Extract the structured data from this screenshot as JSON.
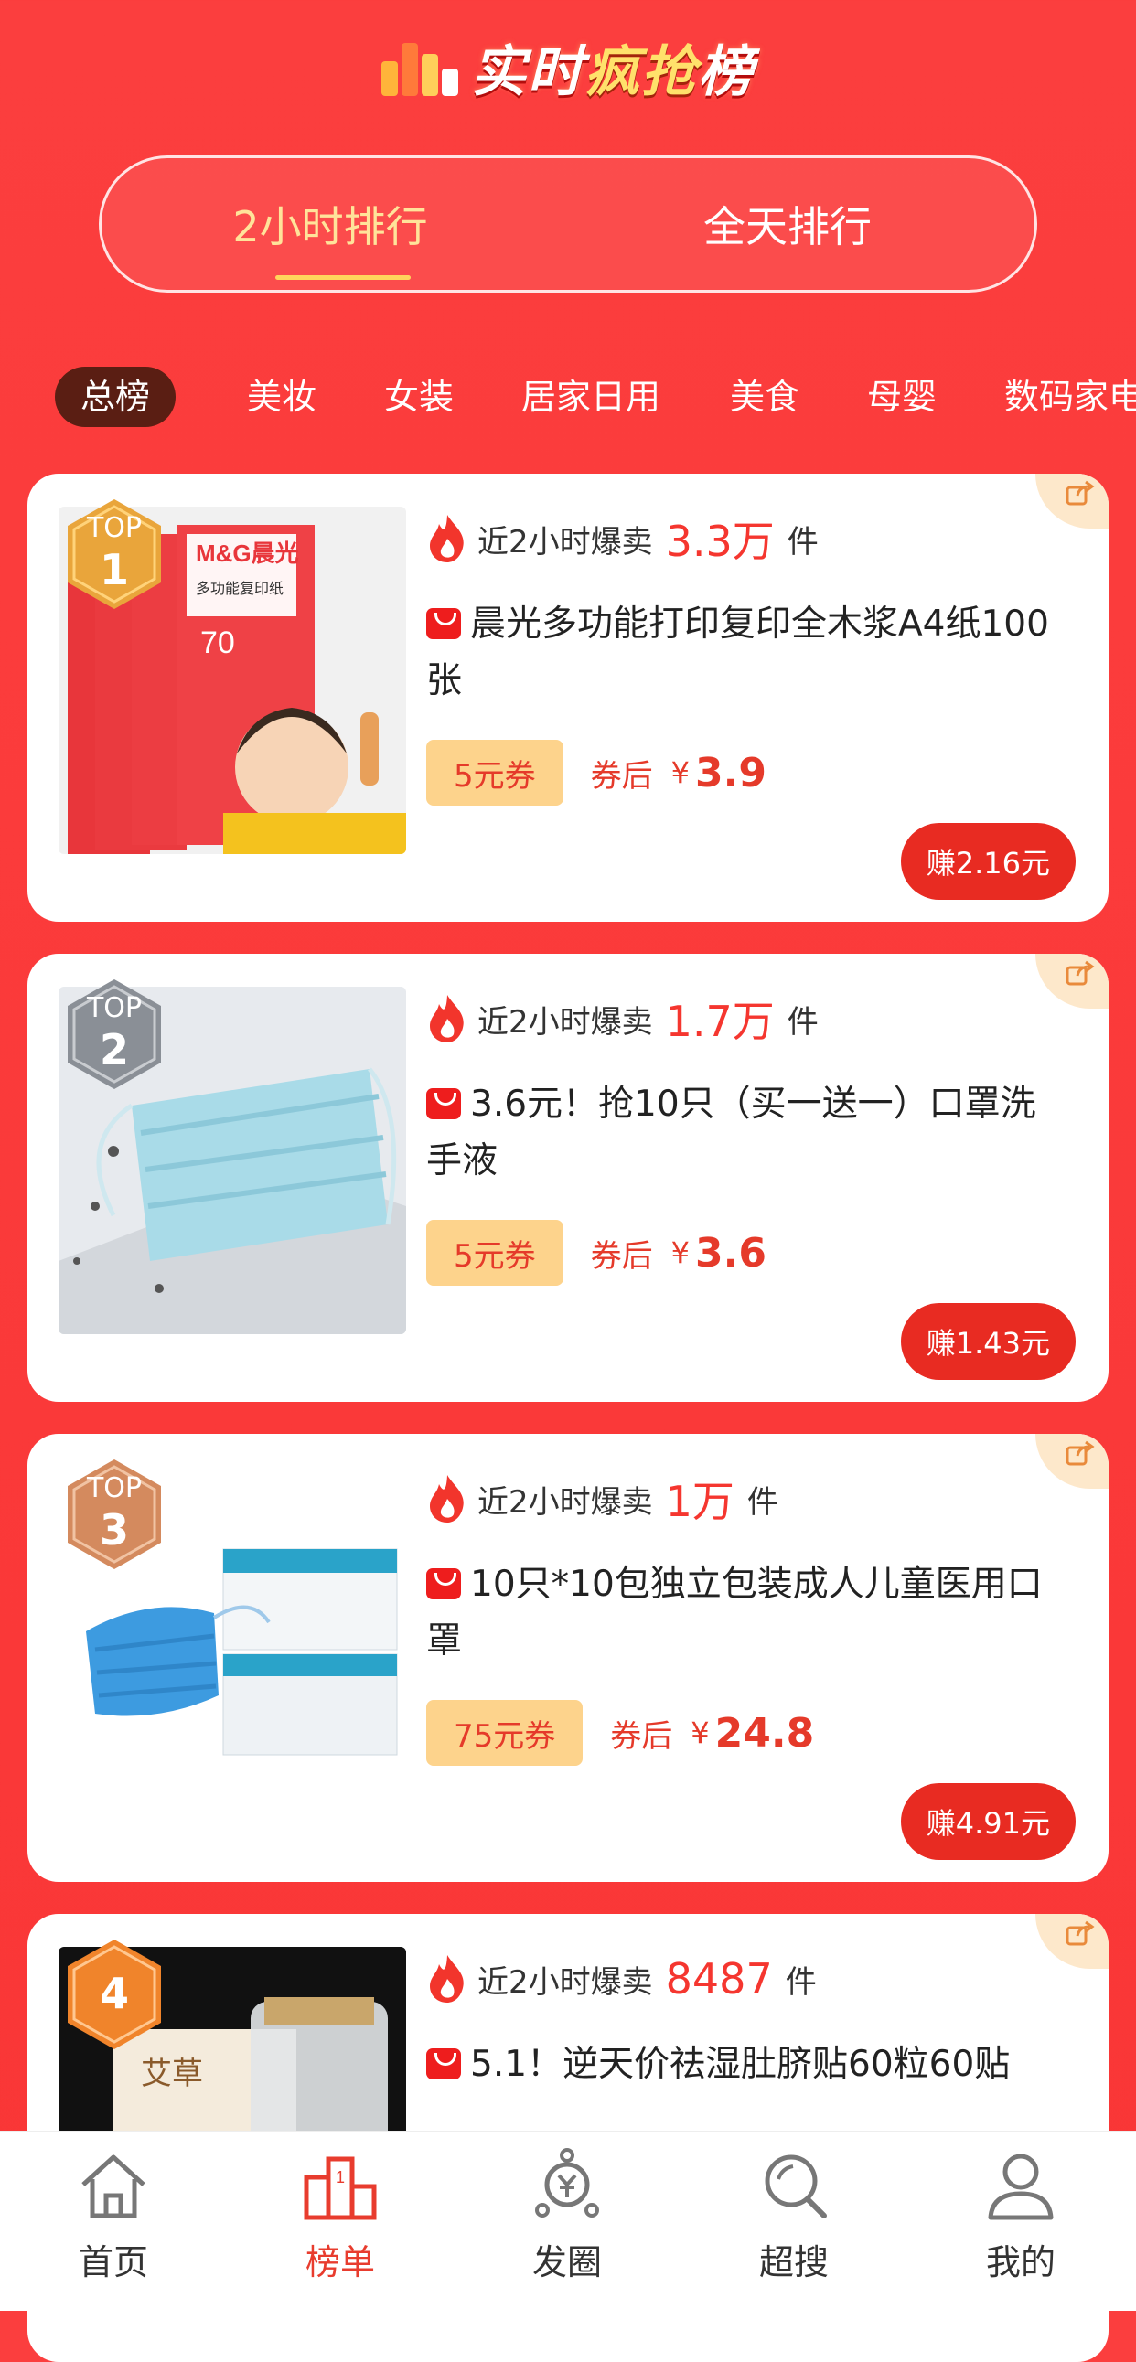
{
  "header": {
    "title_normal": "实时",
    "title_hot": "疯抢",
    "title_end": "榜"
  },
  "tabs": [
    {
      "label": "2小时排行"
    },
    {
      "label": "全天排行"
    }
  ],
  "categories": [
    "总榜",
    "美妆",
    "女装",
    "居家日用",
    "美食",
    "母婴",
    "数码家电"
  ],
  "common": {
    "hot_label": "近2小时爆卖",
    "unit": "件",
    "after_label": "券后",
    "currency": "¥"
  },
  "products": [
    {
      "badge_top": "TOP",
      "rank": "1",
      "sales": "3.3万",
      "title": "晨光多功能打印复印全木浆A4纸100张",
      "coupon": "5元券",
      "price": "3.9",
      "earn": "赚2.16元"
    },
    {
      "badge_top": "TOP",
      "rank": "2",
      "sales": "1.7万",
      "title": "3.6元！抢10只（买一送一）口罩洗手液",
      "coupon": "5元券",
      "price": "3.6",
      "earn": "赚1.43元"
    },
    {
      "badge_top": "TOP",
      "rank": "3",
      "sales": "1万",
      "title": "10只*10包独立包装成人儿童医用口罩",
      "coupon": "75元券",
      "price": "24.8",
      "earn": "赚4.91元"
    },
    {
      "badge_top": "",
      "rank": "4",
      "sales": "8487",
      "title": "5.1！逆天价祛湿肚脐贴60粒60贴"
    }
  ],
  "product_art": {
    "p1_brand": "M&G晨光",
    "p1_pack": "多功能复印纸",
    "p1_gsm": "70",
    "p4_box": "艾草"
  },
  "tabbar": [
    {
      "label": "首页",
      "icon": "home-icon"
    },
    {
      "label": "榜单",
      "icon": "podium-icon"
    },
    {
      "label": "发圈",
      "icon": "yen-share-icon"
    },
    {
      "label": "超搜",
      "icon": "search-icon"
    },
    {
      "label": "我的",
      "icon": "user-icon"
    }
  ],
  "colors": {
    "background": "#fb3b3b",
    "accent": "#e53a2a",
    "coupon_bg": "#fdd38c",
    "active_category_bg": "#5a1e13",
    "tab_active_text": "#ffe39a"
  }
}
